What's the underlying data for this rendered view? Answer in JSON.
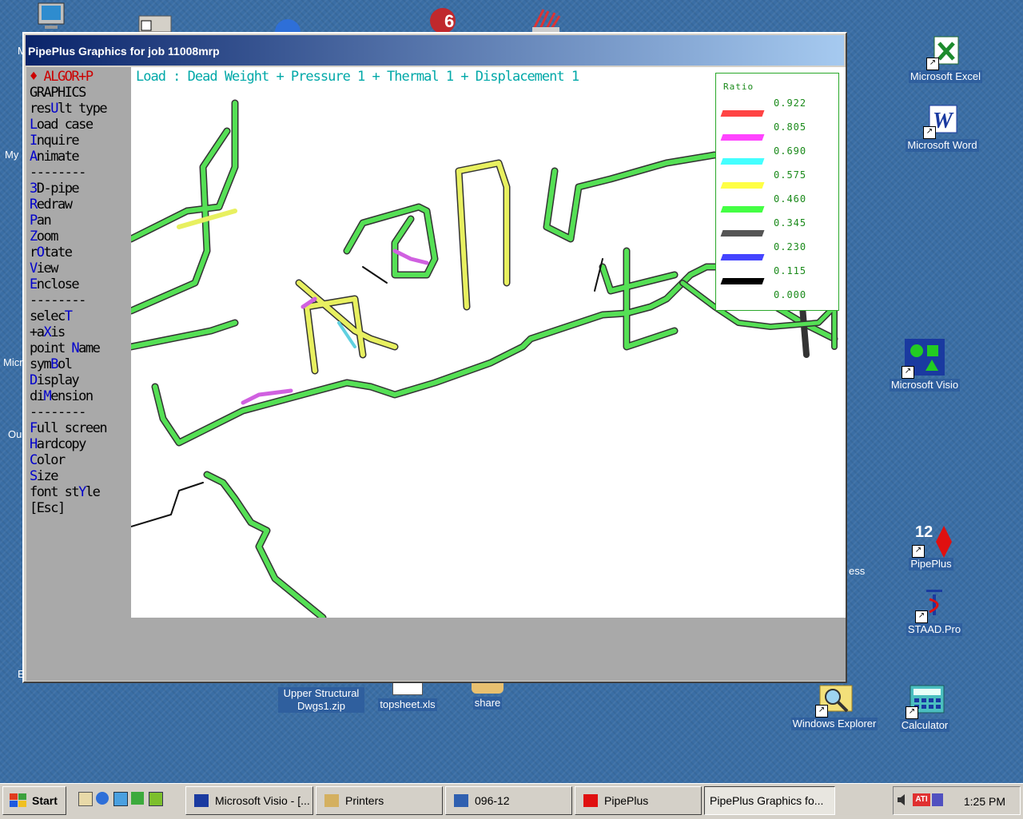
{
  "desktop": {
    "icons": [
      {
        "name": "Microsoft Excel",
        "label": "Microsoft Excel"
      },
      {
        "name": "Microsoft Word",
        "label": "Microsoft Word"
      },
      {
        "name": "Microsoft Visio",
        "label": "Microsoft Visio"
      },
      {
        "name": "PipePlus",
        "label": "PipePlus",
        "badge": "12"
      },
      {
        "name": "STAAD.Pro",
        "label": "STAAD.Pro"
      },
      {
        "name": "Windows Explorer",
        "label": "Windows Explorer"
      },
      {
        "name": "Calculator",
        "label": "Calculator"
      },
      {
        "name": "Upper Structural Dwgs1.zip",
        "label": "Upper Structural Dwgs1.zip"
      },
      {
        "name": "topsheet.xls",
        "label": "topsheet.xls"
      },
      {
        "name": "share",
        "label": "share"
      }
    ],
    "partial_labels": [
      "My",
      "Micr",
      "Ou",
      "E",
      "M",
      "ess"
    ]
  },
  "window": {
    "title": "PipePlus Graphics for job 11008mrp"
  },
  "menu": {
    "items": [
      {
        "pre": "♦ ALGOR+P",
        "hot": "",
        "post": ""
      },
      {
        "pre": "GRAPHICS",
        "hot": "",
        "post": ""
      },
      {
        "pre": "res",
        "hot": "U",
        "post": "lt type"
      },
      {
        "pre": "",
        "hot": "L",
        "post": "oad case"
      },
      {
        "pre": "",
        "hot": "I",
        "post": "nquire"
      },
      {
        "pre": "",
        "hot": "A",
        "post": "nimate"
      },
      {
        "pre": "--------",
        "hot": "",
        "post": ""
      },
      {
        "pre": "",
        "hot": "3",
        "post": "D-pipe"
      },
      {
        "pre": "",
        "hot": "R",
        "post": "edraw"
      },
      {
        "pre": "",
        "hot": "P",
        "post": "an"
      },
      {
        "pre": "",
        "hot": "Z",
        "post": "oom"
      },
      {
        "pre": "r",
        "hot": "O",
        "post": "tate"
      },
      {
        "pre": "",
        "hot": "V",
        "post": "iew"
      },
      {
        "pre": "",
        "hot": "E",
        "post": "nclose"
      },
      {
        "pre": "--------",
        "hot": "",
        "post": ""
      },
      {
        "pre": "selec",
        "hot": "T",
        "post": ""
      },
      {
        "pre": "+a",
        "hot": "X",
        "post": "is"
      },
      {
        "pre": "point ",
        "hot": "N",
        "post": "ame"
      },
      {
        "pre": "sym",
        "hot": "B",
        "post": "ol"
      },
      {
        "pre": "",
        "hot": "D",
        "post": "isplay"
      },
      {
        "pre": "di",
        "hot": "M",
        "post": "ension"
      },
      {
        "pre": "--------",
        "hot": "",
        "post": ""
      },
      {
        "pre": "",
        "hot": "F",
        "post": "ull screen"
      },
      {
        "pre": "",
        "hot": "H",
        "post": "ardcopy"
      },
      {
        "pre": "",
        "hot": "C",
        "post": "olor"
      },
      {
        "pre": "",
        "hot": "S",
        "post": "ize"
      },
      {
        "pre": "font st",
        "hot": "Y",
        "post": "le"
      },
      {
        "pre": "[Esc]",
        "hot": "",
        "post": ""
      }
    ]
  },
  "graphics": {
    "load_title": "Load : Dead Weight + Pressure 1 + Thermal 1 + Displacement 1",
    "legend": {
      "title": "Ratio",
      "entries": [
        {
          "value": "0.922",
          "color": ""
        },
        {
          "value": "0.805",
          "color": "#ff4444"
        },
        {
          "value": "0.690",
          "color": "#ff44ff"
        },
        {
          "value": "0.575",
          "color": "#44ffff"
        },
        {
          "value": "0.460",
          "color": "#ffff44"
        },
        {
          "value": "0.345",
          "color": "#44ff44"
        },
        {
          "value": "0.230",
          "color": "#555555"
        },
        {
          "value": "0.115",
          "color": "#4444ff"
        },
        {
          "value": "0.000",
          "color": "#000000"
        }
      ]
    }
  },
  "taskbar": {
    "start_label": "Start",
    "buttons": [
      {
        "label": "Microsoft Visio - [..."
      },
      {
        "label": "Printers"
      },
      {
        "label": "096-12"
      },
      {
        "label": "PipePlus"
      },
      {
        "label": "PipePlus Graphics fo..."
      }
    ],
    "clock": "1:25 PM"
  }
}
